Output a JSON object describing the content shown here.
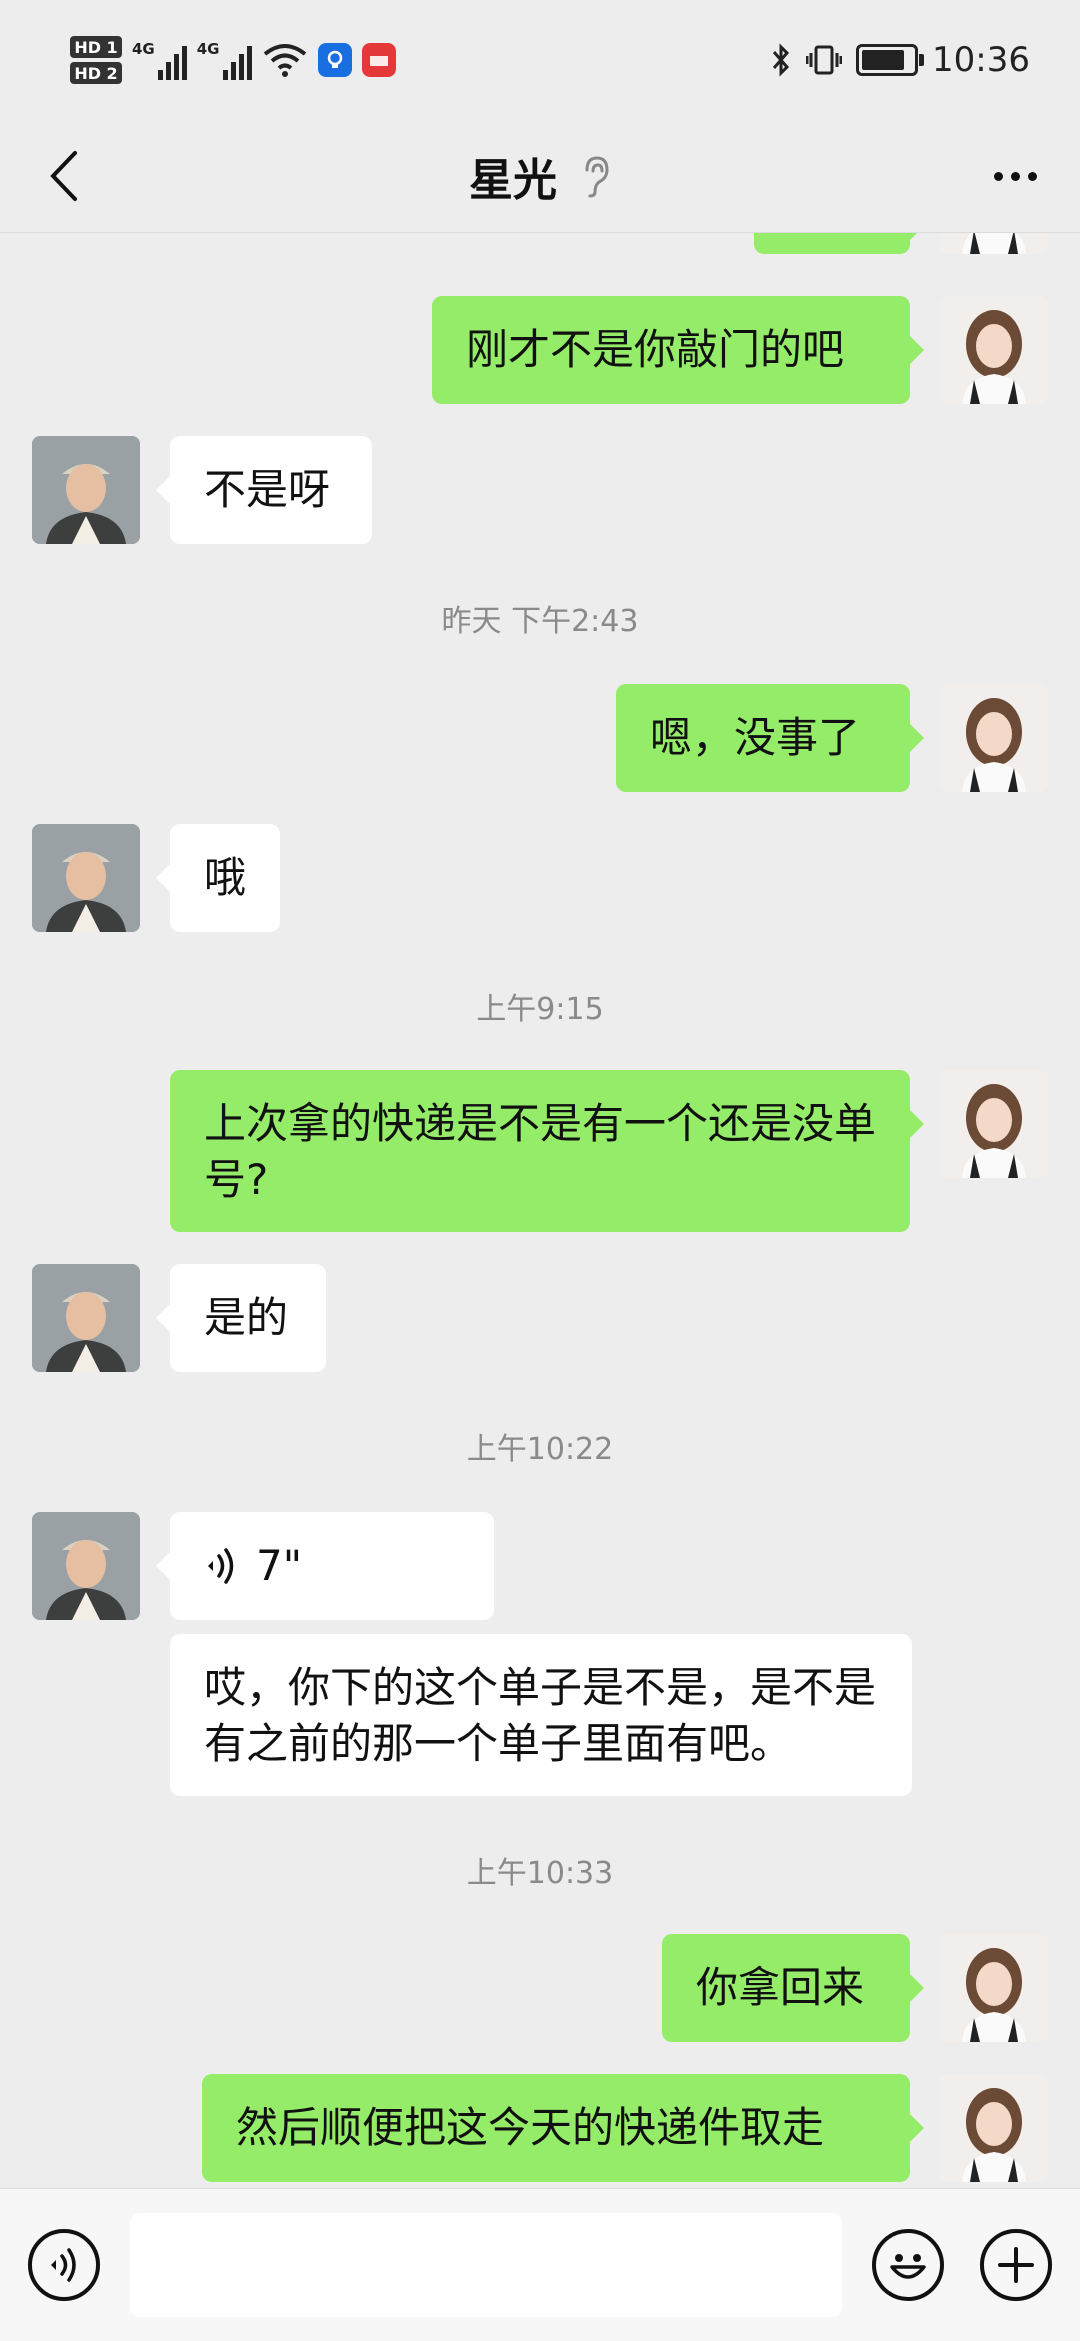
{
  "status_bar": {
    "time": "10:36",
    "sim1": "HD 1",
    "sim2": "HD 2",
    "network1": "4G",
    "network2": "4G"
  },
  "header": {
    "title": "星光",
    "back_icon": "chevron-left-icon",
    "mute_icon": "ear-icon",
    "more_icon": "more-dots-icon"
  },
  "messages": [
    {
      "from": "me",
      "text": "刚才不是你敲门的吧"
    },
    {
      "from": "other",
      "text": "不是呀"
    },
    {
      "timestamp": "昨天 下午2:43"
    },
    {
      "from": "me",
      "text": "嗯，没事了"
    },
    {
      "from": "other",
      "text": "哦"
    },
    {
      "timestamp": "上午9:15"
    },
    {
      "from": "me",
      "text": "上次拿的快递是不是有一个还是没单号?"
    },
    {
      "from": "other",
      "text": "是的"
    },
    {
      "timestamp": "上午10:22"
    },
    {
      "from": "other",
      "type": "voice",
      "duration": "7\""
    },
    {
      "from": "other",
      "type": "transcript",
      "text": "哎，你下的这个单子是不是，是不是有之前的那一个单子里面有吧。"
    },
    {
      "timestamp": "上午10:33"
    },
    {
      "from": "me",
      "text": "你拿回来"
    },
    {
      "from": "me",
      "text": "然后顺便把这今天的快递件取走"
    }
  ],
  "input_bar": {
    "voice_icon": "voice-toggle-icon",
    "emoji_icon": "emoji-icon",
    "plus_icon": "plus-icon",
    "value": ""
  },
  "colors": {
    "me_bubble": "#95ec69",
    "other_bubble": "#ffffff",
    "background": "#ededed"
  }
}
